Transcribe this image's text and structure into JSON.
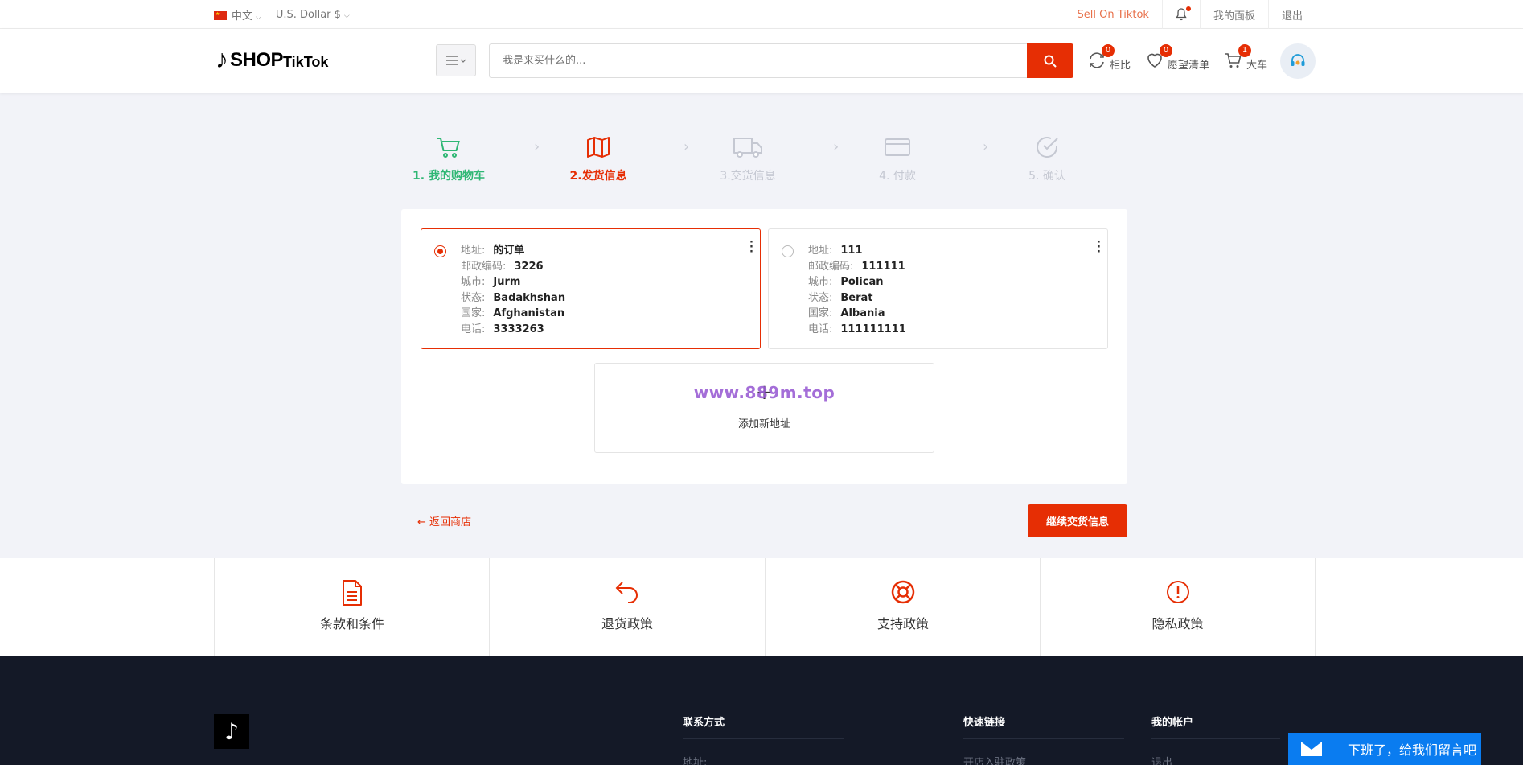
{
  "topbar": {
    "language": "中文",
    "currency": "U.S. Dollar $",
    "sell_link": "Sell On Tiktok",
    "dashboard": "我的面板",
    "logout": "退出"
  },
  "header": {
    "logo_shop": "SHOP",
    "logo_tiktok": "TikTok",
    "search_placeholder": "我是来买什么的...",
    "compare_label": "相比",
    "compare_count": "0",
    "wishlist_label": "愿望清单",
    "wishlist_count": "0",
    "cart_label": "大车",
    "cart_count": "1"
  },
  "steps": [
    {
      "label": "1. 我的购物车",
      "state": "done"
    },
    {
      "label": "2.发货信息",
      "state": "active"
    },
    {
      "label": "3.交货信息",
      "state": "todo"
    },
    {
      "label": "4. 付款",
      "state": "todo"
    },
    {
      "label": "5. 确认",
      "state": "todo"
    }
  ],
  "field_labels": {
    "address": "地址:",
    "postal": "邮政编码:",
    "city": "城市:",
    "state": "状态:",
    "country": "国家:",
    "phone": "电话:"
  },
  "addresses": [
    {
      "address": "的订单",
      "postal": "3226",
      "city": "Jurm",
      "state": "Badakhshan",
      "country": "Afghanistan",
      "phone": "3333263",
      "selected": true
    },
    {
      "address": "111",
      "postal": "111111",
      "city": "Polican",
      "state": "Berat",
      "country": "Albania",
      "phone": "111111111",
      "selected": false
    }
  ],
  "add_address": {
    "plus": "+",
    "label": "添加新地址",
    "watermark": "www.889m.top"
  },
  "actions": {
    "back": "← 返回商店",
    "continue": "继续交货信息"
  },
  "policies": [
    {
      "label": "条款和条件",
      "icon": "document-icon"
    },
    {
      "label": "退货政策",
      "icon": "return-arrow-icon"
    },
    {
      "label": "支持政策",
      "icon": "lifebuoy-icon"
    },
    {
      "label": "隐私政策",
      "icon": "alert-circle-icon"
    }
  ],
  "footer": {
    "contact_heading": "联系方式",
    "contact_item": "地址:",
    "links_heading": "快速链接",
    "links_item": "开店入驻政策",
    "account_heading": "我的帐户",
    "account_item": "退出"
  },
  "chat": {
    "label": "下班了，给我们留言吧"
  },
  "colors": {
    "accent": "#e62e04",
    "done": "#2fb774",
    "todo": "#c5c8d2",
    "footer_bg": "#141927",
    "chat_bg": "#0a7cf0"
  }
}
